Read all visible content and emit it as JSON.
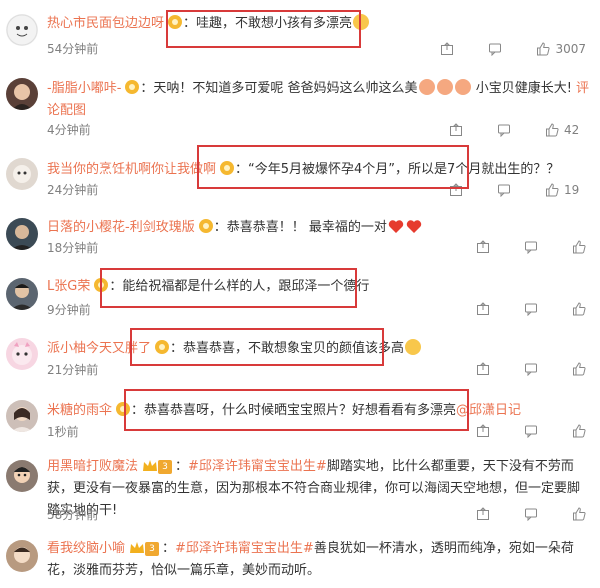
{
  "comments": [
    {
      "user": "热心市民面包边边呀",
      "text": "哇趣，不敢想小孩有多漂亮",
      "time": "54分钟前",
      "likes": "3007",
      "avatar_color": "#e6e6e6"
    },
    {
      "user": "-脂脂小嘟咔-",
      "text": "天呐！不知道多可爱呢 爸爸妈妈这么帅这么美",
      "text_tail": "小宝贝健康长大!",
      "link": "评论配图",
      "time": "4分钟前",
      "likes": "42",
      "avatar_color": "#5a4038"
    },
    {
      "user": "我当你的烹饪机啊你让我做啊",
      "text": "“今年5月被爆怀孕4个月”，所以是7个月就出生的？？",
      "time": "24分钟前",
      "likes": "19",
      "avatar_color": "#d8cfc6"
    },
    {
      "user": "日落的小樱花-利剑玫瑰版",
      "text": "恭喜恭喜！！ 最幸福的一对",
      "time": "18分钟前",
      "likes": "",
      "avatar_color": "#3b4a55"
    },
    {
      "user": "L张G荣",
      "text": "能给祝福都是什么样的人，跟邱泽一个德行",
      "time": "9分钟前",
      "likes": "",
      "avatar_color": "#4a5560"
    },
    {
      "user": "派小柚今天又胖了",
      "text": "恭喜恭喜，不敢想象宝贝的颜值该多高",
      "time": "21分钟前",
      "likes": "",
      "avatar_color": "#f0b6c9"
    },
    {
      "user": "米糖的雨伞",
      "text": "恭喜恭喜呀，什么时候晒宝宝照片？好想看看有多漂亮",
      "mention": "@邱潇日记",
      "time": "1秒前",
      "likes": "",
      "avatar_color": "#c9b8b0"
    },
    {
      "user": "用黑暗打败魔法",
      "level": "3",
      "tag": "#邱泽许玮甯宝宝出生#",
      "text": "脚踏实地，比什么都重要，天下没有不劳而获，更没有一夜暴富的生意，因为那根本不符合商业规律，你可以海阔天空地想，但一定要脚踏实地的干!",
      "time": "58分钟前",
      "likes": "",
      "avatar_color": "#7a6a60"
    },
    {
      "user": "看我绞脑小喻",
      "level": "3",
      "tag": "#邱泽许玮甯宝宝出生#",
      "text": "善良犹如一杯清水，透明而纯净，宛如一朵荷花，淡雅而芬芳，恰似一篇乐章，美妙而动听。",
      "time": "",
      "likes": "",
      "avatar_color": "#b89a80"
    }
  ],
  "colors": {
    "username": "#eb7350",
    "highlight_box": "#d83a3a",
    "meta": "#808080"
  },
  "icons": [
    "share-icon",
    "comment-icon",
    "like-icon",
    "level-badge-icon",
    "vip-crown-icon"
  ]
}
